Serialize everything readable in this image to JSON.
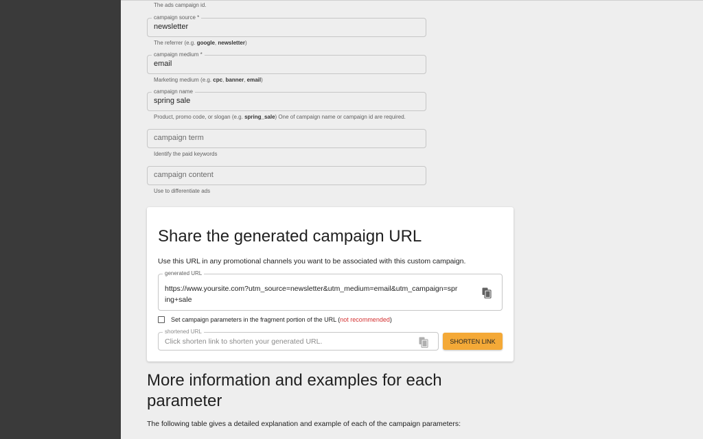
{
  "campaign_id_helper": "The ads campaign id.",
  "source": {
    "label": "campaign source *",
    "value": "newsletter",
    "helper_prefix": "The referrer (e.g. ",
    "helper_ex1": "google",
    "helper_sep": ", ",
    "helper_ex2": "newsletter",
    "helper_suffix": ")"
  },
  "medium": {
    "label": "campaign medium *",
    "value": "email",
    "helper_prefix": "Marketing medium (e.g. ",
    "helper_ex1": "cpc",
    "helper_sep1": ", ",
    "helper_ex2": "banner",
    "helper_sep2": ", ",
    "helper_ex3": "email",
    "helper_suffix": ")"
  },
  "name": {
    "label": "campaign name",
    "value": "spring sale",
    "helper_prefix": "Product, promo code, or slogan (e.g. ",
    "helper_ex1": "spring_sale",
    "helper_suffix": ") One of campaign name or campaign id are required."
  },
  "term": {
    "placeholder": "campaign term",
    "helper": "Identify the paid keywords"
  },
  "content": {
    "placeholder": "campaign content",
    "helper": "Use to differentiate ads"
  },
  "share": {
    "title": "Share the generated campaign URL",
    "description": "Use this URL in any promotional channels you want to be associated with this custom campaign.",
    "generated_label": "generated URL",
    "generated_url": "https://www.yoursite.com?utm_source=newsletter&utm_medium=email&utm_campaign=spring+sale",
    "fragment_label": "Set campaign parameters in the fragment portion of the URL (",
    "fragment_warning": "not recommended",
    "fragment_close": ")",
    "shortened_label": "shortened URL",
    "shortened_placeholder": "Click shorten link to shorten your generated URL.",
    "shorten_button": "SHORTEN LINK"
  },
  "more": {
    "title": "More information and examples for each parameter",
    "description": "The following table gives a detailed explanation and example of each of the campaign parameters:"
  },
  "colors": {
    "accent": "#f4a937",
    "warning": "#d32f2f",
    "sidebar": "#3a3a3a",
    "background": "#eeeeee"
  },
  "icons": {
    "copy": "copy-icon"
  }
}
